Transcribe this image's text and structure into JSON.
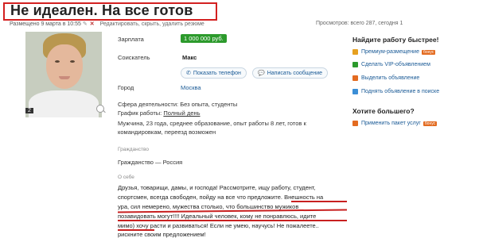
{
  "header": {
    "title": "Не идеален. На все готов",
    "posted": "Размещено 9 марта в 10:55",
    "actions": "Редактировать, скрыть, удалить резюме",
    "views": "Просмотров: всего 287, сегодня 1"
  },
  "photo": {
    "count": "2"
  },
  "fields": {
    "salary_label": "Зарплата",
    "salary_value": "1 000 000 руб.",
    "applicant_label": "Соискатель",
    "applicant_value": "Макс",
    "show_phone": "Показать телефон",
    "write_message": "Написать сообщение",
    "city_label": "Город",
    "city_value": "Москва"
  },
  "details": {
    "sphere": "Сфера деятельности: Без опыта, студенты",
    "schedule_prefix": "График работы: ",
    "schedule_value": "Полный день",
    "summary_1": "Мужчина, 23 года, среднее образование, опыт работы 8 лет, готов к",
    "summary_2": "командировкам, переезд возможен"
  },
  "citizenship": {
    "heading": "Гражданство",
    "value": "Гражданство — Россия"
  },
  "about": {
    "heading": "О себе",
    "lines": [
      "Друзья, товарищи, дамы, и господа! Рассмотрите, ищу работу, студент,",
      "спортсмен, всегда свободен, пойду на все что предложите. Внешность на",
      "ура, сил немерено, мужества столько, что большинство мужиков",
      "позавидовать могут!!!! Идеальный человек, кому не понравлюсь, идите",
      "мимо) хочу расти и развиваться! Если не умею, научусь! Не пожалеете..",
      "рискните своим предложением!"
    ]
  },
  "sidebar": {
    "find_heading": "Найдите работу быстрее!",
    "find_items": [
      {
        "label": "Премиум-размещение",
        "badge": "бонус",
        "icon": "crown-icon",
        "color": "#e6a020"
      },
      {
        "label": "Сделать VIP-объявлением",
        "badge": "",
        "icon": "vip-icon",
        "color": "#2c9a2c"
      },
      {
        "label": "Выделить объявление",
        "badge": "",
        "icon": "highlight-icon",
        "color": "#e36b20"
      },
      {
        "label": "Поднять объявление в поиске",
        "badge": "",
        "icon": "arrow-up-icon",
        "color": "#3b8ed6"
      }
    ],
    "more_heading": "Хотите большего?",
    "more_item": {
      "label": "Применить пакет услуг",
      "badge": "бонус",
      "icon": "package-icon",
      "color": "#e36b20"
    }
  }
}
